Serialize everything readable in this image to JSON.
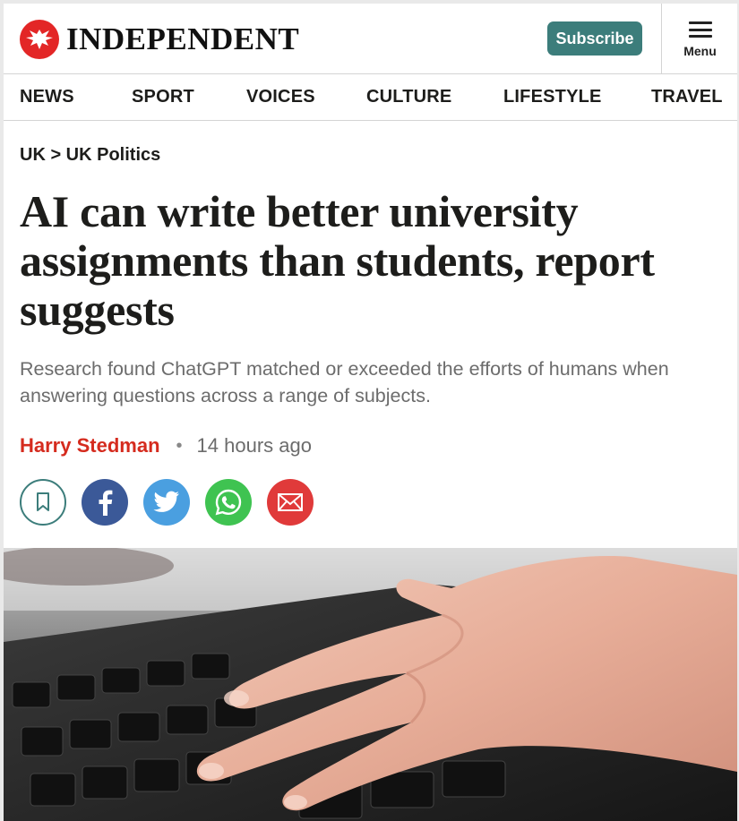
{
  "header": {
    "logo_text": "INDEPENDENT",
    "subscribe_label": "Subscribe",
    "menu_label": "Menu"
  },
  "nav": {
    "items": [
      "NEWS",
      "SPORT",
      "VOICES",
      "CULTURE",
      "LIFESTYLE",
      "TRAVEL"
    ]
  },
  "article": {
    "breadcrumb": "UK > UK Politics",
    "headline": "AI can write better university assignments than students, report suggests",
    "standfirst": "Research found ChatGPT matched or exceeded the efforts of humans when answering questions across a range of subjects.",
    "author": "Harry Stedman",
    "separator": "•",
    "time": "14 hours ago"
  },
  "share": {
    "buttons": [
      {
        "icon": "bookmark-icon",
        "color": "#3c7d7b"
      },
      {
        "icon": "facebook-icon",
        "color": "#3b5998"
      },
      {
        "icon": "twitter-icon",
        "color": "#4a9fe0"
      },
      {
        "icon": "whatsapp-icon",
        "color": "#3fc351"
      },
      {
        "icon": "email-icon",
        "color": "#e03a3a"
      }
    ]
  },
  "colors": {
    "brand_red": "#e32626",
    "subscribe_teal": "#3c7d7b",
    "author_red": "#d52b1e"
  },
  "hero_image": {
    "subject": "hand-typing-on-laptop-keyboard"
  }
}
